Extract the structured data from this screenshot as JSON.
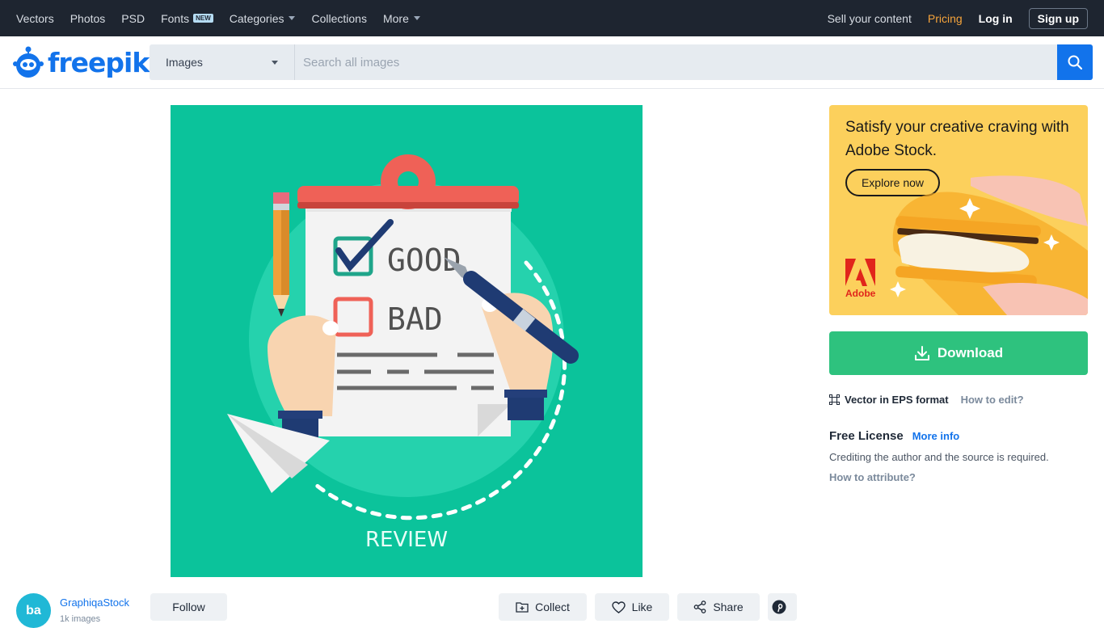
{
  "topnav": {
    "left": [
      {
        "label": "Vectors"
      },
      {
        "label": "Photos"
      },
      {
        "label": "PSD"
      },
      {
        "label": "Fonts",
        "badge": "NEW"
      },
      {
        "label": "Categories",
        "dropdown": true
      },
      {
        "label": "Collections"
      },
      {
        "label": "More",
        "dropdown": true
      }
    ],
    "sell": "Sell your content",
    "pricing": "Pricing",
    "login": "Log in",
    "signup": "Sign up"
  },
  "header": {
    "logo_text": "freepik",
    "search_type": "Images",
    "search_placeholder": "Search all images",
    "search_icon": "search-icon"
  },
  "main_image": {
    "good_label": "GOOD",
    "bad_label": "BAD",
    "caption": "REVIEW"
  },
  "ad": {
    "title": "Satisfy your creative craving with Adobe Stock.",
    "button": "Explore now",
    "brand": "Adobe"
  },
  "download": {
    "label": "Download",
    "icon": "download-icon"
  },
  "format": {
    "label": "Vector in EPS format",
    "how_to_edit": "How to edit?"
  },
  "license": {
    "title": "Free License",
    "more_info": "More info",
    "description": "Crediting the author and the source is required.",
    "how_to_attribute": "How to attribute?"
  },
  "author": {
    "avatar_text": "ba",
    "name": "GraphiqaStock",
    "count": "1k images",
    "follow": "Follow"
  },
  "actions": {
    "collect": "Collect",
    "like": "Like",
    "share": "Share"
  },
  "colors": {
    "nav_bg": "#1e2530",
    "brand_blue": "#1273eb",
    "download_green": "#2ec27e",
    "pricing_orange": "#f6a43b",
    "image_bg": "#0bc39b",
    "ad_bg": "#fcd05c"
  }
}
